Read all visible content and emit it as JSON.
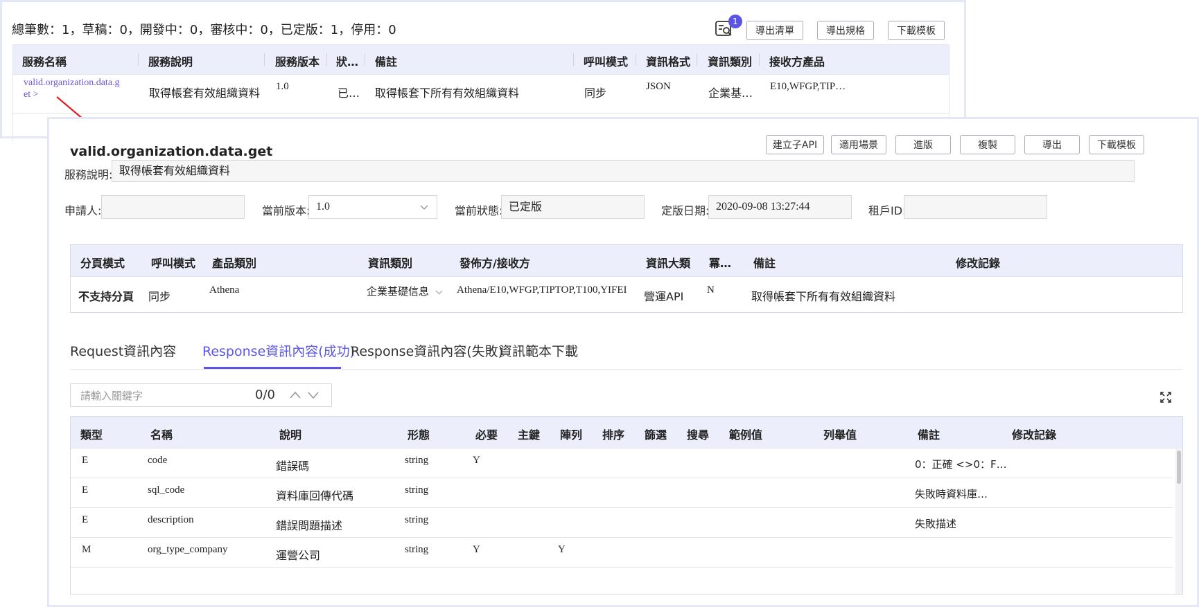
{
  "list_view": {
    "summary": "總筆數：1，草稿：0，開發中：0，審核中：0，已定版：1，停用：0",
    "notification_count": "1",
    "buttons": {
      "export_list": "導出清單",
      "export_spec": "導出規格",
      "download_template": "下載模板"
    },
    "columns": [
      "服務名稱",
      "服務說明",
      "服務版本",
      "狀…",
      "備註",
      "呼叫模式",
      "資訊格式",
      "資訊類別",
      "接收方產品"
    ],
    "row": {
      "name_line1": "valid.organization.data.g",
      "name_line2": "et >",
      "description": "取得帳套有效組織資料",
      "version": "1.0",
      "status": "已…",
      "remark": "取得帳套下所有有效組織資料",
      "call_mode": "同步",
      "format": "JSON",
      "category": "企業基…",
      "receiver": "E10,WFGP,TIP…"
    }
  },
  "detail": {
    "title": "valid.organization.data.get",
    "buttons": {
      "create_sub_api": "建立子API",
      "scenario": "適用場景",
      "upgrade": "進版",
      "copy": "複製",
      "export": "導出",
      "download_template": "下載模板"
    },
    "description_label": "服務說明:",
    "description_value": "取得帳套有效組織資料",
    "applicant_label": "申請人:",
    "applicant_value": "",
    "version_label": "當前版本:",
    "version_value": "1.0",
    "status_label": "當前狀態:",
    "status_value": "已定版",
    "release_date_label": "定版日期:",
    "release_date_value": "2020-09-08 13:27:44",
    "tenant_label": "租戶ID:",
    "tenant_value": "",
    "meta_columns": [
      "分頁模式",
      "呼叫模式",
      "產品類別",
      "資訊類別",
      "發佈方/接收方",
      "資訊大類",
      "冪…",
      "備註",
      "修改記錄"
    ],
    "meta_row": {
      "paging": "不支持分頁",
      "call_mode": "同步",
      "product": "Athena",
      "category": "企業基礎信息",
      "publisher": "Athena/E10,WFGP,TIPTOP,T100,YIFEI",
      "info_type": "營運API",
      "idempotent": "N",
      "remark": "取得帳套下所有有效組織資料",
      "history": ""
    },
    "tabs": [
      "Request資訊內容",
      "Response資訊內容(成功)",
      "Response資訊內容(失敗)",
      "資訊範本下載"
    ],
    "active_tab": 1,
    "search": {
      "placeholder": "請輸入關鍵字",
      "count": "0/0"
    },
    "field_columns": [
      "類型",
      "名稱",
      "說明",
      "形態",
      "必要",
      "主鍵",
      "陣列",
      "排序",
      "篩選",
      "搜尋",
      "範例值",
      "列舉值",
      "備註",
      "修改記錄"
    ],
    "field_rows": [
      {
        "type": "E",
        "name": "code",
        "desc": "錯誤碼",
        "dtype": "string",
        "required": "Y",
        "array": "",
        "remark": "0：正確 <>0：F…"
      },
      {
        "type": "E",
        "name": "sql_code",
        "desc": "資料庫回傳代碼",
        "dtype": "string",
        "required": "",
        "array": "",
        "remark": "失敗時資料庫…"
      },
      {
        "type": "E",
        "name": "description",
        "desc": "錯誤問題描述",
        "dtype": "string",
        "required": "",
        "array": "",
        "remark": "失敗描述"
      },
      {
        "type": "M",
        "name": "org_type_company",
        "desc": "運營公司",
        "dtype": "string",
        "required": "Y",
        "array": "Y",
        "remark": ""
      }
    ]
  },
  "colors": {
    "accent": "#5b55e6",
    "header_bg": "#eceefb",
    "arrow": "#e02020"
  },
  "icons": [
    "list-search-icon",
    "chevron-down-icon",
    "chevron-up-icon",
    "expand-icon",
    "arrow-annotation"
  ]
}
